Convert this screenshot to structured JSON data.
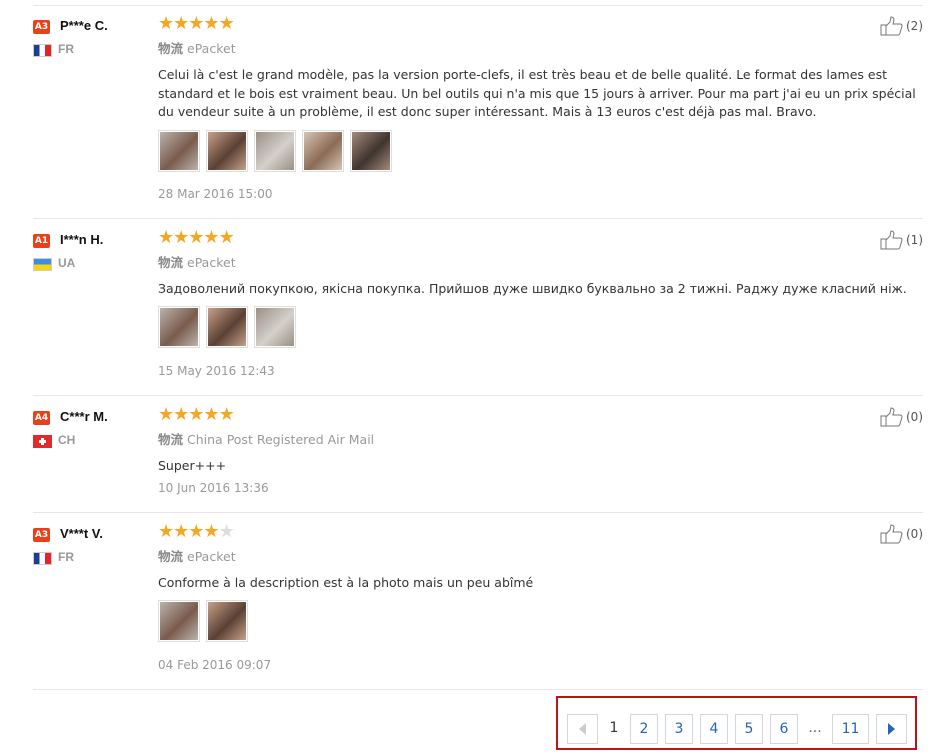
{
  "reviews": [
    {
      "level": "A3",
      "user": "P***e C.",
      "country": "FR",
      "flag": "fr",
      "stars": 5,
      "ship_cn": "物流",
      "ship_method": "ePacket",
      "text": "Celui là c'est le grand modèle, pas la version porte-clefs, il est très beau et de belle qualité. Le format des lames est standard et le bois est vraiment beau. Un bel outils qui n'a mis que 15 jours à arriver. Pour ma part j'ai eu un prix spécial du vendeur suite à un problème, il est donc super intéressant. Mais à 13 euros c'est déjà pas mal. Bravo.",
      "photos": 5,
      "date": "28 Mar 2016 15:00",
      "helpful": "(2)"
    },
    {
      "level": "A1",
      "user": "I***n H.",
      "country": "UA",
      "flag": "ua",
      "stars": 5,
      "ship_cn": "物流",
      "ship_method": "ePacket",
      "text": "Задоволений покупкою, якісна покупка. Прийшов дуже швидко буквально за 2 тижні. Раджу дуже класний ніж.",
      "photos": 3,
      "date": "15 May 2016 12:43",
      "helpful": "(1)"
    },
    {
      "level": "A4",
      "user": "C***r M.",
      "country": "CH",
      "flag": "ch",
      "stars": 5,
      "ship_cn": "物流",
      "ship_method": "China Post Registered Air Mail",
      "text": "Super+++",
      "photos": 0,
      "date": "10 Jun 2016 13:36",
      "helpful": "(0)"
    },
    {
      "level": "A3",
      "user": "V***t V.",
      "country": "FR",
      "flag": "fr",
      "stars": 4,
      "ship_cn": "物流",
      "ship_method": "ePacket",
      "text": "Conforme à la description est à la photo mais un peu abîmé",
      "photos": 2,
      "date": "04 Feb 2016 09:07",
      "helpful": "(0)"
    }
  ],
  "pagination": {
    "current": "1",
    "pages": [
      "2",
      "3",
      "4",
      "5",
      "6"
    ],
    "ellipsis": "...",
    "last": "11",
    "prev_icon": "chevron-left-icon",
    "next_icon": "chevron-right-icon"
  },
  "colors": {
    "star": "#f5a623",
    "level_badge": "#e8401a",
    "link": "#2366b8",
    "highlight": "#c0111a"
  }
}
